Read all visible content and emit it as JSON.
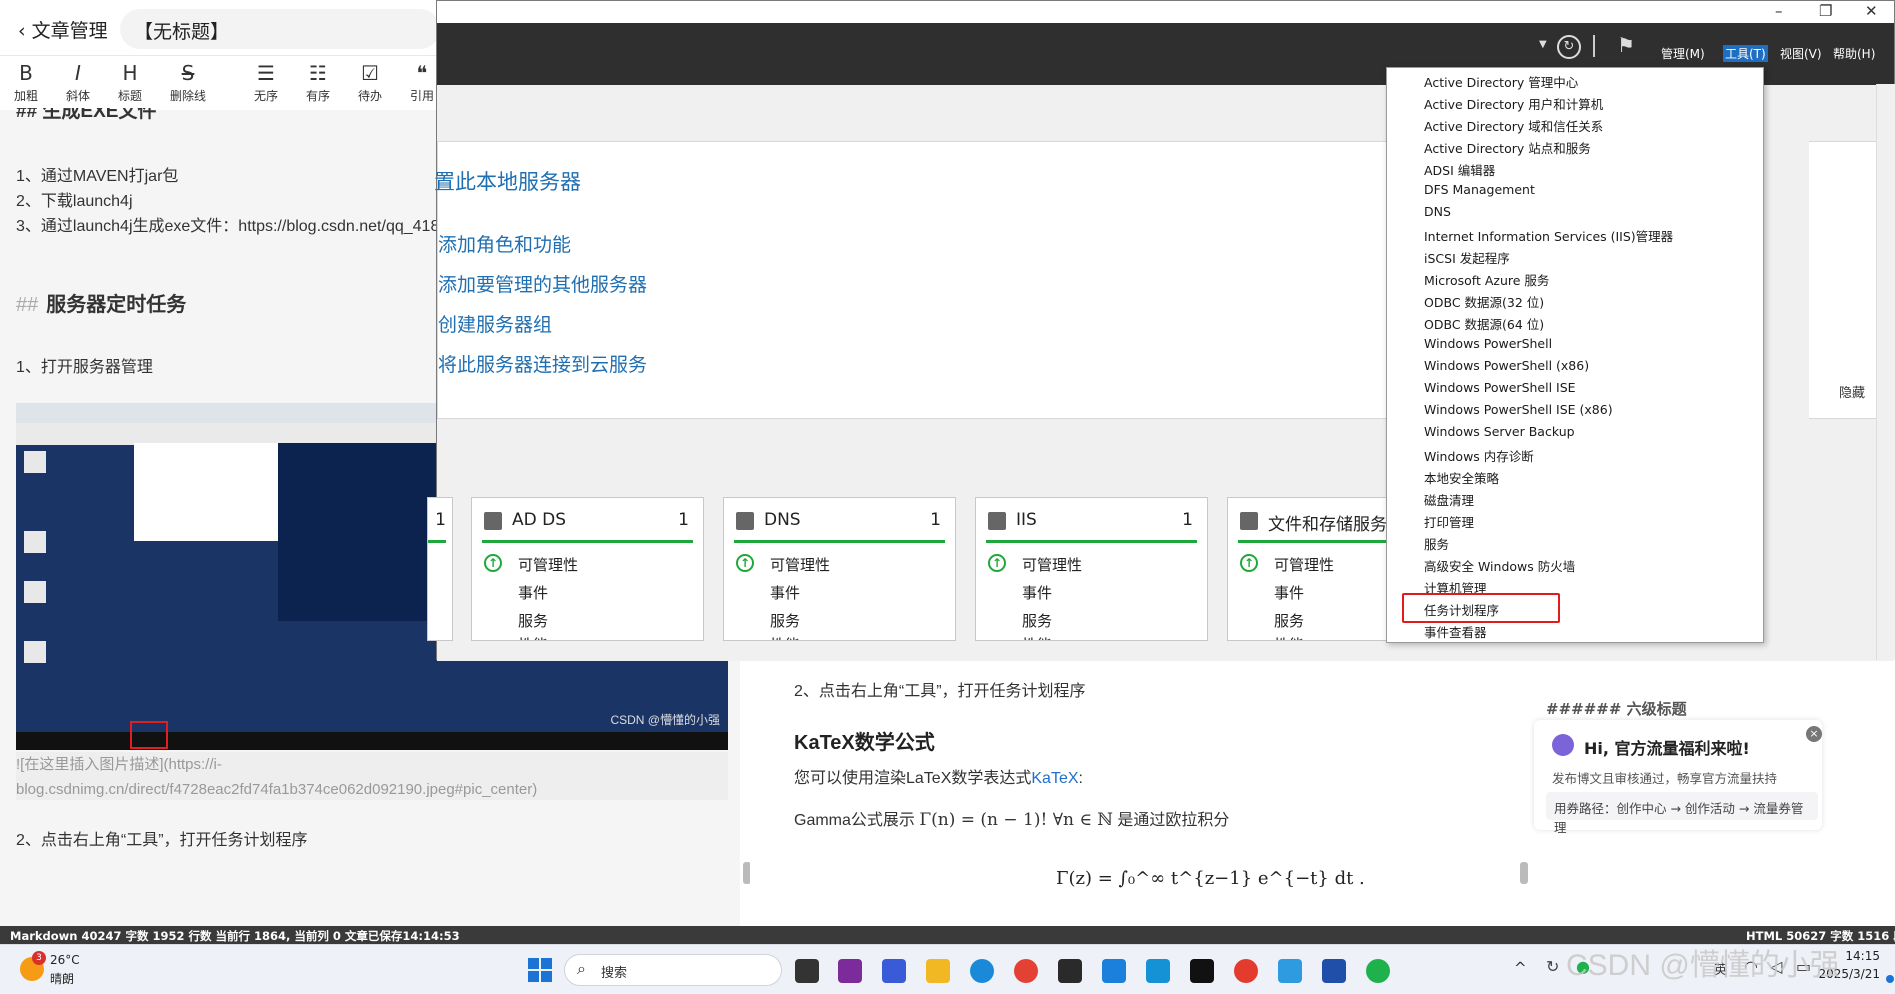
{
  "editor": {
    "back_label": "文章管理",
    "title_value": "【无标题】",
    "toolbar": [
      {
        "g": "B",
        "l": "加粗"
      },
      {
        "g": "I",
        "l": "斜体"
      },
      {
        "g": "H",
        "l": "标题"
      },
      {
        "g": "S",
        "l": "删除线"
      },
      {
        "g": "☰",
        "l": "无序"
      },
      {
        "g": "☷",
        "l": "有序"
      },
      {
        "g": "☑",
        "l": "待办"
      },
      {
        "g": "❝",
        "l": "引用"
      }
    ],
    "cut_heading": "## 生成EXE文件",
    "steps": [
      "1、通过MAVEN打jar包",
      "2、下载launch4j",
      "3、通过launch4j生成exe文件：https://blog.csdn.net/qq_418"
    ],
    "h2_hash": "##",
    "h2_title": "服务器定时任务",
    "step_open": "1、打开服务器管理",
    "embedded_watermark": "CSDN @懵懂的小强",
    "alt_text": "![在这里插入图片描述](https://i-blog.csdnimg.cn/direct/f4728eac2fd74fa1b374ce062d092190.jpeg#pic_center)",
    "step2": "2、点击右上角“工具”，打开任务计划程序"
  },
  "preview": {
    "step2": "2、点击右上角“工具”，打开任务计划程序",
    "katex_title": "KaTeX数学公式",
    "katex_intro": "您可以使用渲染LaTeX数学表达式",
    "katex_link": "KaTeX",
    "katex_colon": ":",
    "gamma_prefix": "Gamma公式展示",
    "gamma_formula": "Γ(n) = (n − 1)!  ∀n ∈ ℕ",
    "gamma_suffix": "是通过欧拉积分",
    "integral": "Γ(z) = ∫₀^∞ t^{z−1} e^{−t} dt ."
  },
  "sidebar": {
    "heading": "###### 六级标题",
    "promo_title": "Hi, 官方流量福利来啦!",
    "promo_desc": "发布博文且审核通过，畅享官方流量扶持",
    "promo_path": "用券路径：创作中心 → 创作活动 → 流量券管理"
  },
  "server_manager": {
    "menus": [
      "管理(M)",
      "工具(T)",
      "视图(V)",
      "帮助(H)"
    ],
    "quick_title": "置此本地服务器",
    "quick_links": [
      "添加角色和功能",
      "添加要管理的其他服务器",
      "创建服务器组",
      "将此服务器连接到云服务"
    ],
    "hide": "隐藏",
    "cards": [
      {
        "name": "",
        "count": "1"
      },
      {
        "name": "AD DS",
        "count": "1"
      },
      {
        "name": "DNS",
        "count": "1"
      },
      {
        "name": "IIS",
        "count": "1"
      },
      {
        "name": "文件和存储服务",
        "count": ""
      }
    ],
    "card_rows": [
      "可管理性",
      "事件",
      "服务",
      "性能"
    ]
  },
  "tools_menu": [
    "Active Directory 管理中心",
    "Active Directory 用户和计算机",
    "Active Directory 域和信任关系",
    "Active Directory 站点和服务",
    "ADSI 编辑器",
    "DFS Management",
    "DNS",
    "Internet Information Services (IIS)管理器",
    "iSCSI 发起程序",
    "Microsoft Azure 服务",
    "ODBC 数据源(32 位)",
    "ODBC 数据源(64 位)",
    "Windows PowerShell",
    "Windows PowerShell (x86)",
    "Windows PowerShell ISE",
    "Windows PowerShell ISE (x86)",
    "Windows Server Backup",
    "Windows 内存诊断",
    "本地安全策略",
    "磁盘清理",
    "打印管理",
    "服务",
    "高级安全 Windows 防火墙",
    "计算机管理",
    "任务计划程序",
    "事件查看器"
  ],
  "highlighted_item": "任务计划程序",
  "status_bar": {
    "left": "Markdown  40247 字数  1952 行数  当前行 1864, 当前列 0  文章已保存14:14:53",
    "right": "HTML  50627 字数  1516 段"
  },
  "taskbar": {
    "weather_temp": "26°C",
    "weather_desc": "晴朗",
    "badge": "3",
    "search_label": "搜索",
    "time": "14:15",
    "date": "2025/3/21",
    "watermark": "CSDN @懵懂的小强"
  }
}
